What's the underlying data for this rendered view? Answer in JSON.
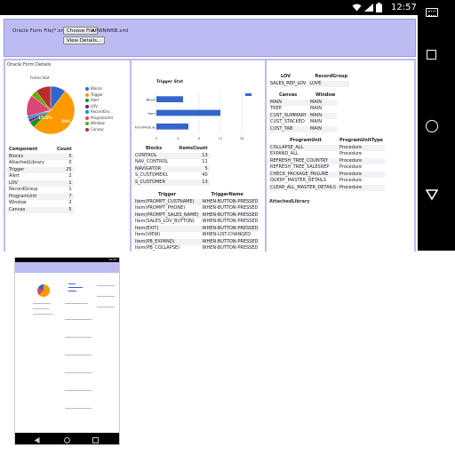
{
  "status_bar": {
    "time": "12:57",
    "icons": [
      "wifi-icon",
      "signal-icon",
      "battery-icon"
    ]
  },
  "nav_bar": {
    "icons": [
      "keyboard-icon",
      "recents-icon",
      "home-icon",
      "back-icon"
    ]
  },
  "file_panel": {
    "label": "Oracle Form File(*.xml)",
    "choose_button": "Choose File",
    "file_name": "APWNWKB.xml",
    "view_details_button": "View Details..."
  },
  "panel1": {
    "title": "Oracle Form Details",
    "pie_title": "Forms Stat",
    "pie_labels": [
      "15.6%",
      "50%"
    ],
    "legend": [
      {
        "name": "Blocks",
        "color": "#3366cc"
      },
      {
        "name": "Trigger",
        "color": "#ff9900"
      },
      {
        "name": "Alert",
        "color": "#109618"
      },
      {
        "name": "LOV",
        "color": "#990099"
      },
      {
        "name": "RecordGro...",
        "color": "#0099c6"
      },
      {
        "name": "ProgramUnit",
        "color": "#dd4477"
      },
      {
        "name": "Window",
        "color": "#66aa00"
      },
      {
        "name": "Canvas",
        "color": "#b82e2e"
      }
    ],
    "table_headers": [
      "Component",
      "Count"
    ],
    "table_rows": [
      [
        "Blocks",
        "5"
      ],
      [
        "AttachedLibrary",
        "0"
      ],
      [
        "Trigger",
        "25"
      ],
      [
        "Alert",
        "2"
      ],
      [
        "LOV",
        "1"
      ],
      [
        "RecordGroup",
        "1"
      ],
      [
        "ProgramUnit",
        "7"
      ],
      [
        "Window",
        "2"
      ],
      [
        "Canvas",
        "5"
      ]
    ]
  },
  "panel2": {
    "chart_title": "Trigger Stat",
    "blocks_headers": [
      "Blocks",
      "ItemsCount"
    ],
    "blocks_rows": [
      [
        "CONTROL",
        "13"
      ],
      [
        "NAV_CONTROL",
        "11"
      ],
      [
        "NAVIGATOR",
        "5"
      ],
      [
        "S_CUSTOMER1",
        "40"
      ],
      [
        "S_CUSTOMER",
        "13"
      ]
    ],
    "trigger_headers": [
      "Trigger",
      "TriggerName"
    ],
    "trigger_rows": [
      [
        "Item(PROMPT_CUSTNAME)",
        "WHEN-BUTTON-PRESSED"
      ],
      [
        "Item(PROMPT_PHONE)",
        "WHEN-BUTTON-PRESSED"
      ],
      [
        "Item(PROMPT_SALES_NAME)",
        "WHEN-BUTTON-PRESSED"
      ],
      [
        "Item(SALES_LOV_BUTTON)",
        "WHEN-BUTTON-PRESSED"
      ],
      [
        "Item(EXIT)",
        "WHEN-BUTTON-PRESSED"
      ],
      [
        "Item(VIEW)",
        "WHEN-LIST-CHANGED"
      ],
      [
        "Item(PB_EXPAND)",
        "WHEN-BUTTON-PRESSED"
      ],
      [
        "Item(PB_COLLAPSE)",
        "WHEN-BUTTON-PRESSED"
      ]
    ]
  },
  "panel3": {
    "lov_headers": [
      "LOV",
      "RecordGroup"
    ],
    "lov_rows": [
      [
        "SALES_REP_LOV",
        "LOVE"
      ]
    ],
    "canvas_headers": [
      "Canvas",
      "Window"
    ],
    "canvas_rows": [
      [
        "MAIN",
        "MAIN"
      ],
      [
        "TREE",
        "MAIN"
      ],
      [
        "CUST_SUMMARY",
        "MAIN"
      ],
      [
        "CUST_STACKED",
        "MAIN"
      ],
      [
        "CUST_TAB",
        "MAIN"
      ]
    ],
    "program_headers": [
      "ProgramUnit",
      "ProgramUnitType"
    ],
    "program_rows": [
      [
        "COLLAPSE_ALL",
        "Procedure"
      ],
      [
        "EXPAND_ALL",
        "Procedure"
      ],
      [
        "REFRESH_TREE_COUNTRY",
        "Procedure"
      ],
      [
        "REFRESH_TREE_SALESREP",
        "Procedure"
      ],
      [
        "CHECK_PACKAGE_FAILURE",
        "Procedure"
      ],
      [
        "QUERY_MASTER_DETAILS",
        "Procedure"
      ],
      [
        "CLEAR_ALL_MASTER_DETAILS",
        "Procedure"
      ]
    ],
    "attached_library_label": "AttachedLibrary"
  },
  "thumbnail": {
    "time": "12:29"
  },
  "chart_data": [
    {
      "type": "pie",
      "title": "Forms Stat",
      "categories": [
        "Blocks",
        "Trigger",
        "Alert",
        "LOV",
        "RecordGroup",
        "ProgramUnit",
        "Window",
        "Canvas"
      ],
      "values": [
        5,
        25,
        2,
        1,
        1,
        7,
        2,
        5
      ],
      "colors": [
        "#3366cc",
        "#ff9900",
        "#109618",
        "#990099",
        "#0099c6",
        "#dd4477",
        "#66aa00",
        "#b82e2e"
      ],
      "legend": "right"
    },
    {
      "type": "bar",
      "orientation": "horizontal",
      "title": "Trigger Stat",
      "categories": [
        "Block",
        "Item",
        "FormModule"
      ],
      "values": [
        5,
        12,
        6
      ],
      "xlim": [
        0,
        16
      ],
      "x_ticks": [
        "0",
        "4",
        "8",
        "12",
        "16"
      ],
      "color": "#3366cc",
      "grid": true
    }
  ]
}
